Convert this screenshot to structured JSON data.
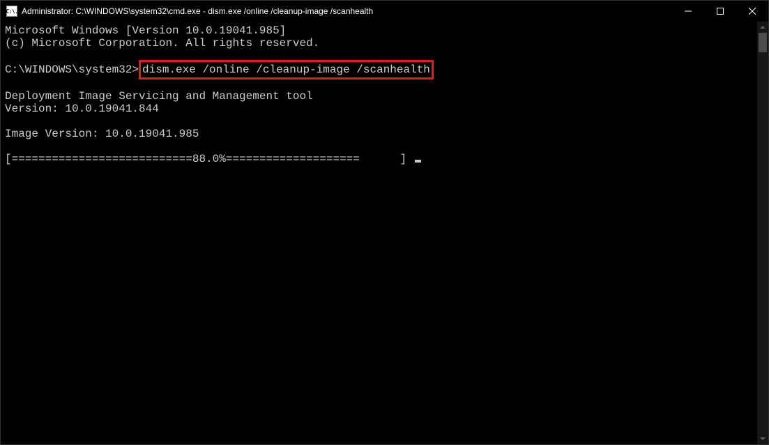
{
  "window": {
    "icon_text": "C:\\.",
    "title": "Administrator: C:\\WINDOWS\\system32\\cmd.exe - dism.exe  /online /cleanup-image /scanhealth"
  },
  "terminal": {
    "line1": "Microsoft Windows [Version 10.0.19041.985]",
    "line2": "(c) Microsoft Corporation. All rights reserved.",
    "prompt_prefix": "C:\\WINDOWS\\system32>",
    "command": "dism.exe /online /cleanup-image /scanhealth",
    "tool_line1": "Deployment Image Servicing and Management tool",
    "tool_line2": "Version: 10.0.19041.844",
    "image_version": "Image Version: 10.0.19041.985",
    "progress": "[===========================88.0%====================      ] "
  }
}
